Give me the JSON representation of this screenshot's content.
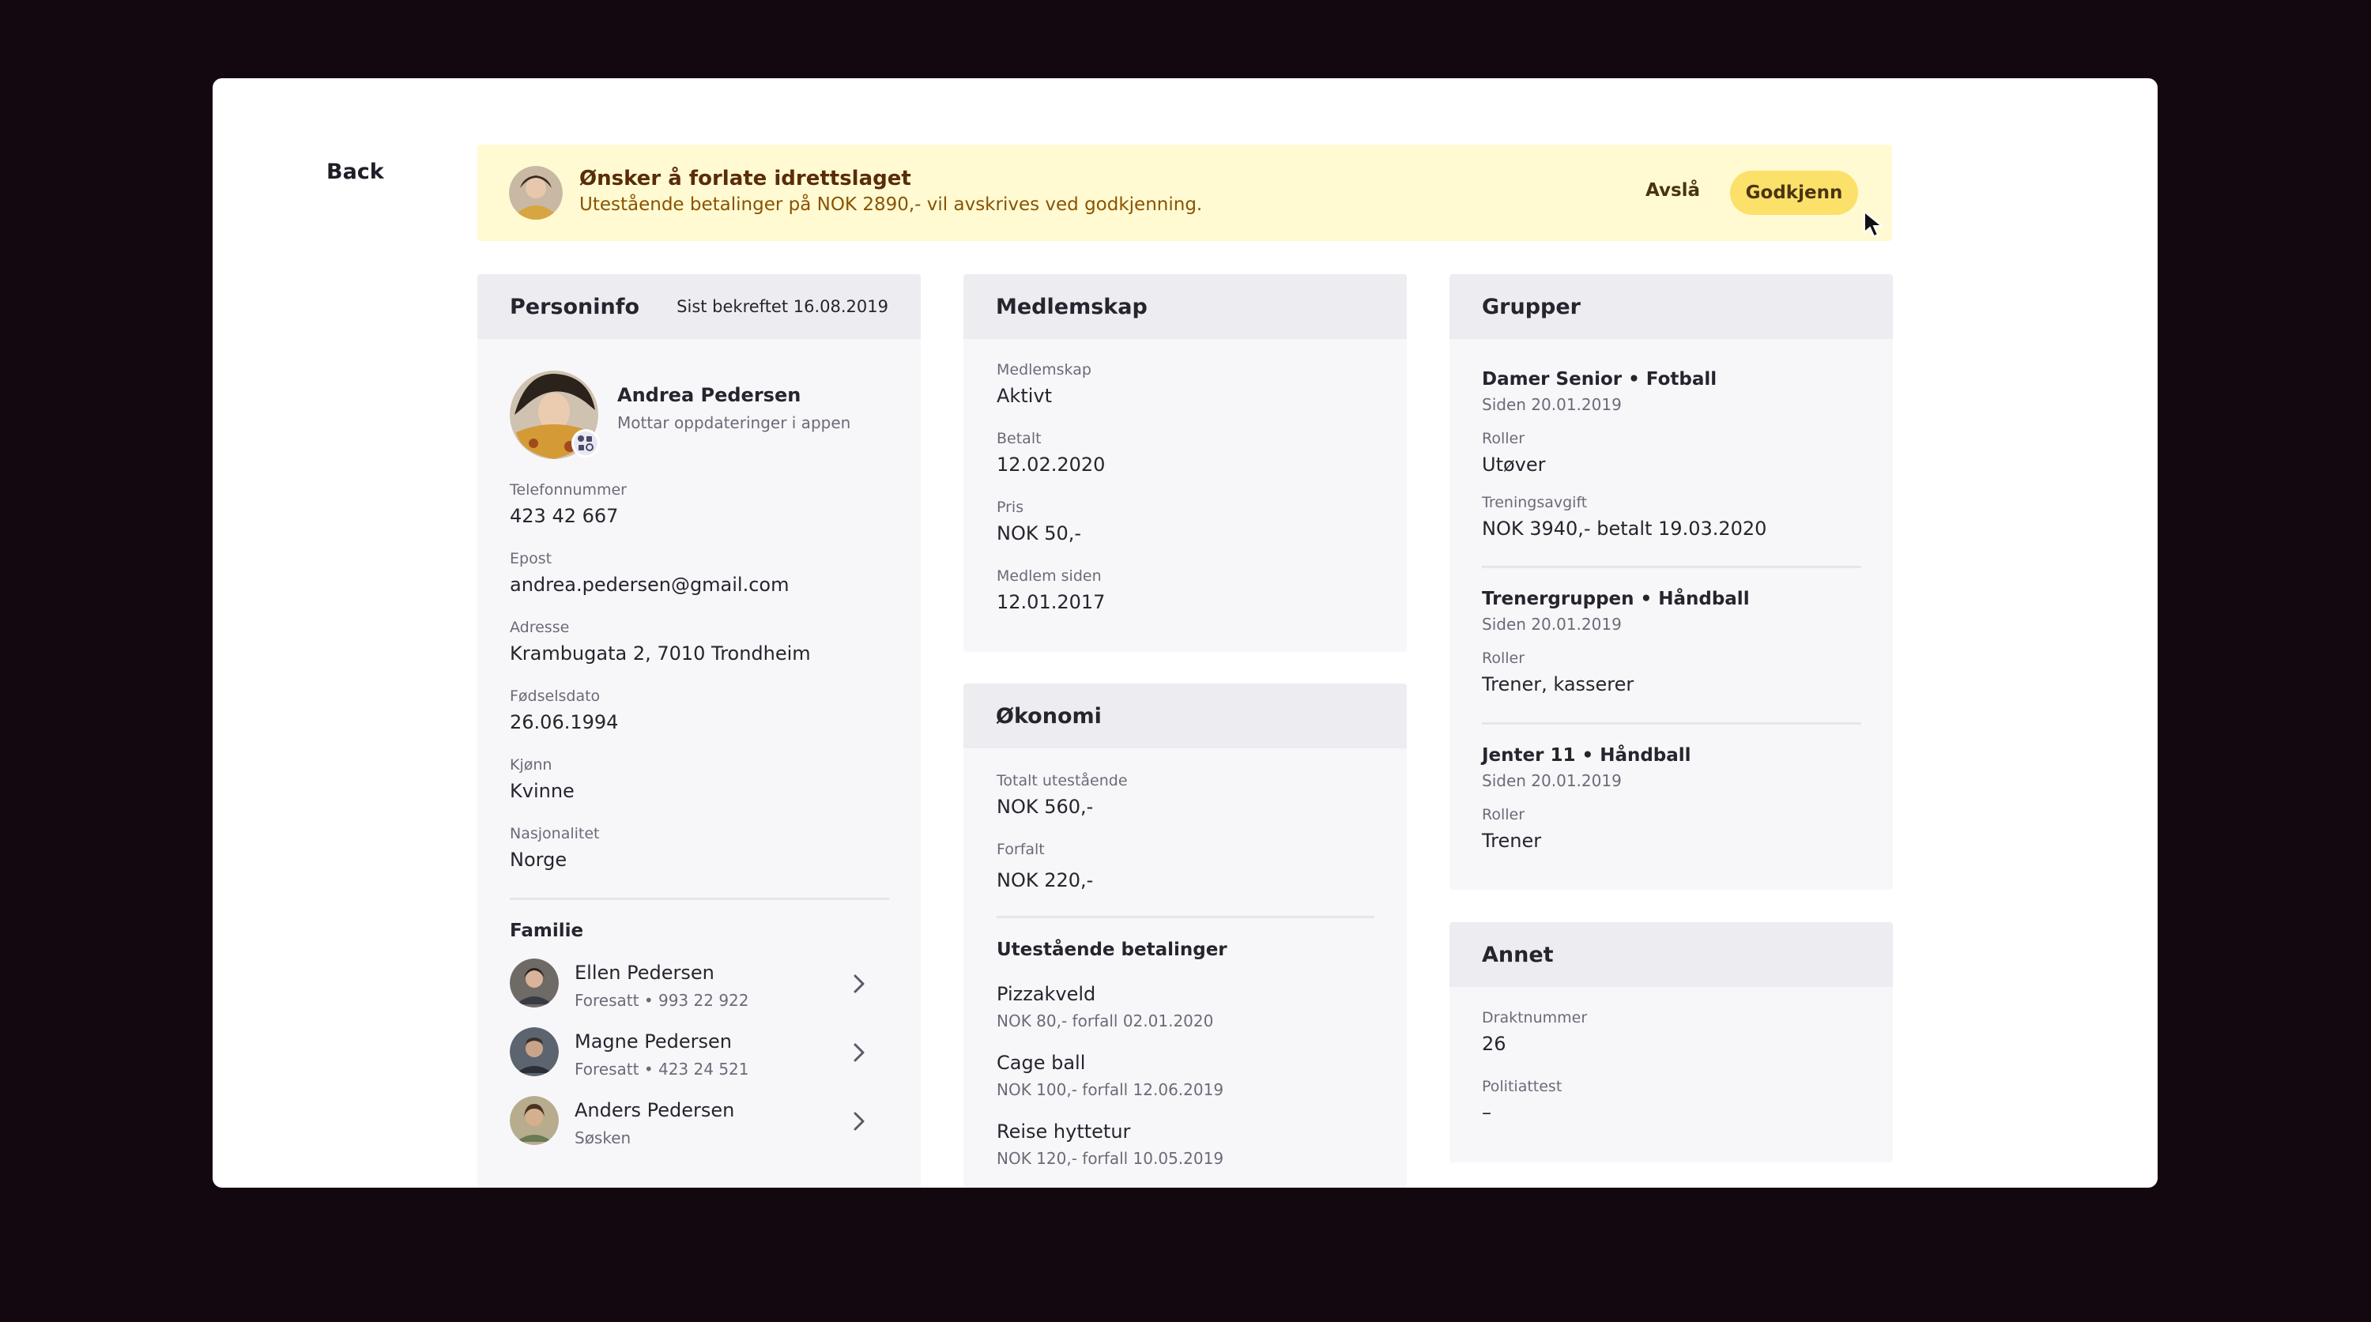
{
  "nav": {
    "back_label": "Back"
  },
  "banner": {
    "title": "Ønsker å forlate idrettslaget",
    "subtitle": "Utestående betalinger på NOK 2890,- vil avskrives ved godkjenning.",
    "decline_label": "Avslå",
    "approve_label": "Godkjenn"
  },
  "personinfo": {
    "title": "Personinfo",
    "confirmed": "Sist bekreftet 16.08.2019",
    "name": "Andrea Pedersen",
    "name_sub": "Mottar oppdateringer i appen",
    "fields": [
      {
        "label": "Telefonnummer",
        "value": "423 42 667"
      },
      {
        "label": "Epost",
        "value": "andrea.pedersen@gmail.com"
      },
      {
        "label": "Adresse",
        "value": "Krambugata 2, 7010 Trondheim"
      },
      {
        "label": "Fødselsdato",
        "value": "26.06.1994"
      },
      {
        "label": "Kjønn",
        "value": "Kvinne"
      },
      {
        "label": "Nasjonalitet",
        "value": "Norge"
      }
    ],
    "family_title": "Familie",
    "family": [
      {
        "name": "Ellen Pedersen",
        "sub": "Foresatt • 993 22 922"
      },
      {
        "name": "Magne Pedersen",
        "sub": "Foresatt • 423 24 521"
      },
      {
        "name": "Anders Pedersen",
        "sub": "Søsken"
      }
    ]
  },
  "medlemskap": {
    "title": "Medlemskap",
    "fields": [
      {
        "label": "Medlemskap",
        "value": "Aktivt"
      },
      {
        "label": "Betalt",
        "value": "12.02.2020"
      },
      {
        "label": "Pris",
        "value": "NOK 50,-"
      },
      {
        "label": "Medlem siden",
        "value": "12.01.2017"
      }
    ]
  },
  "okonomi": {
    "title": "Økonomi",
    "fields": [
      {
        "label": "Totalt utestående",
        "value": "NOK 560,-"
      },
      {
        "label": "Forfalt",
        "value": "NOK 220,-"
      }
    ],
    "payments_title": "Utestående betalinger",
    "payments": [
      {
        "name": "Pizzakveld",
        "sub": "NOK 80,- forfall 02.01.2020"
      },
      {
        "name": "Cage ball",
        "sub": "NOK 100,- forfall 12.06.2019"
      },
      {
        "name": "Reise hyttetur",
        "sub": "NOK 120,- forfall 10.05.2019"
      }
    ]
  },
  "grupper": {
    "title": "Grupper",
    "groups": [
      {
        "name": "Damer Senior • Fotball",
        "since": "Siden 20.01.2019",
        "role_label": "Roller",
        "role": "Utøver",
        "fee_label": "Treningsavgift",
        "fee": "NOK 3940,- betalt 19.03.2020"
      },
      {
        "name": "Trenergruppen • Håndball",
        "since": "Siden 20.01.2019",
        "role_label": "Roller",
        "role": "Trener, kasserer"
      },
      {
        "name": "Jenter 11 • Håndball",
        "since": "Siden 20.01.2019",
        "role_label": "Roller",
        "role": "Trener"
      }
    ]
  },
  "annet": {
    "title": "Annet",
    "fields": [
      {
        "label": "Draktnummer",
        "value": "26"
      },
      {
        "label": "Politiattest",
        "value": "–"
      }
    ]
  },
  "colors": {
    "banner_bg": "#fffad2",
    "approve_bg": "#fbe06a",
    "card_bg": "#f7f7fa",
    "card_head_bg": "#ececf1"
  }
}
